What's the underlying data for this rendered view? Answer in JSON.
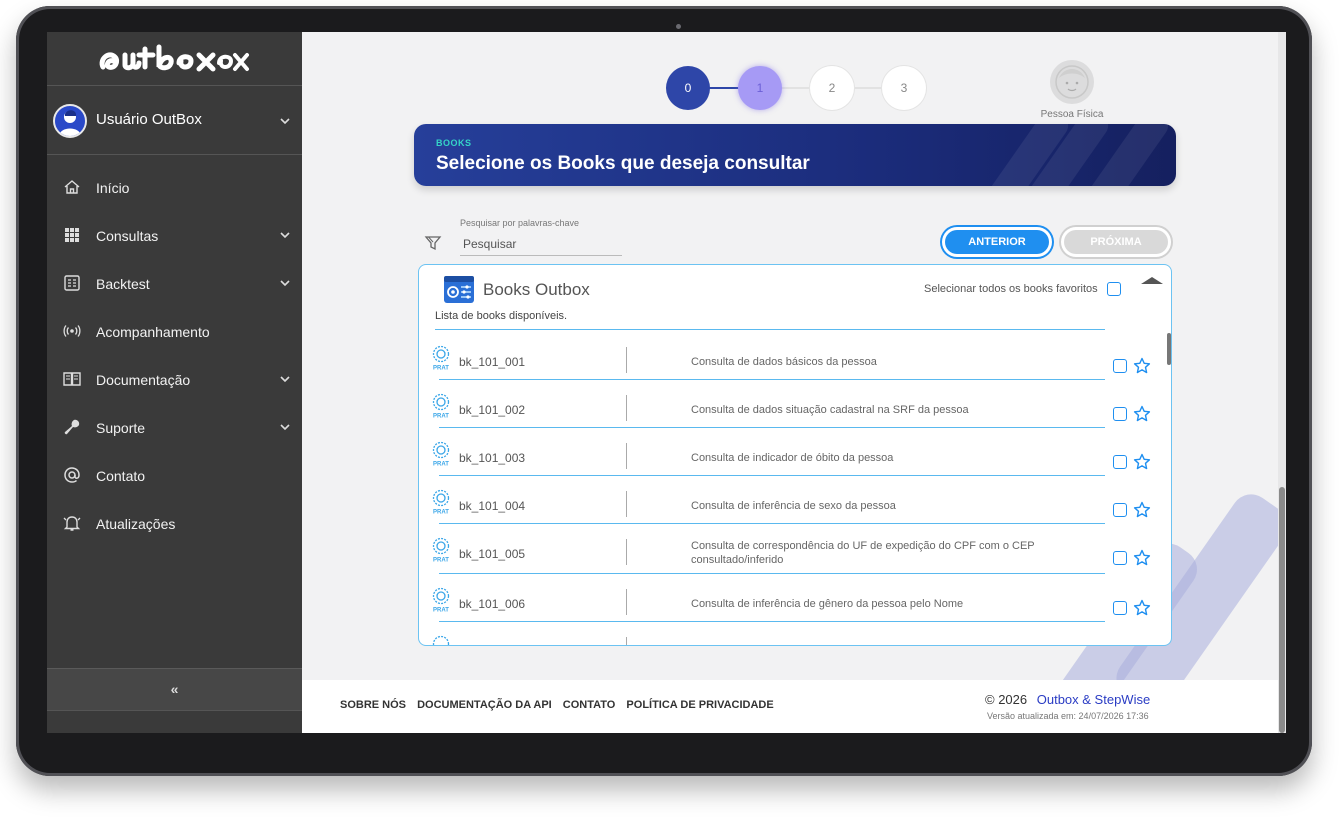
{
  "brand": {
    "logo_text": "outbox"
  },
  "user": {
    "name": "Usuário OutBox"
  },
  "sidebar": {
    "items": [
      {
        "label": "Início",
        "icon": "home-icon",
        "has_submenu": false
      },
      {
        "label": "Consultas",
        "icon": "grid-icon",
        "has_submenu": true
      },
      {
        "label": "Backtest",
        "icon": "backtest-icon",
        "has_submenu": true
      },
      {
        "label": "Acompanhamento",
        "icon": "broadcast-icon",
        "has_submenu": false
      },
      {
        "label": "Documentação",
        "icon": "book-icon",
        "has_submenu": true
      },
      {
        "label": "Suporte",
        "icon": "wrench-icon",
        "has_submenu": true
      },
      {
        "label": "Contato",
        "icon": "at-icon",
        "has_submenu": false
      },
      {
        "label": "Atualizações",
        "icon": "bell-icon",
        "has_submenu": false
      }
    ],
    "collapse_label": "«"
  },
  "stepper": {
    "steps": [
      {
        "label": "0",
        "state": "completed"
      },
      {
        "label": "1",
        "state": "active"
      },
      {
        "label": "2",
        "state": "pending"
      },
      {
        "label": "3",
        "state": "pending"
      }
    ],
    "person_label": "Pessoa Física"
  },
  "banner": {
    "tag": "BOOKS",
    "title": "Selecione os Books que deseja consultar"
  },
  "search": {
    "label": "Pesquisar por palavras-chave",
    "placeholder": "Pesquisar",
    "value": ""
  },
  "nav_buttons": {
    "previous": "ANTERIOR",
    "next": "PRÓXIMA"
  },
  "panel": {
    "title": "Books Outbox",
    "subtitle": "Lista de books disponíveis.",
    "select_all_favorites": "Selecionar todos os books favoritos",
    "badge_text": "PRAT",
    "books": [
      {
        "code": "bk_101_001",
        "description": "Consulta de dados básicos da pessoa"
      },
      {
        "code": "bk_101_002",
        "description": "Consulta de dados situação cadastral na SRF da pessoa"
      },
      {
        "code": "bk_101_003",
        "description": "Consulta de indicador de óbito da pessoa"
      },
      {
        "code": "bk_101_004",
        "description": "Consulta de inferência de sexo da pessoa"
      },
      {
        "code": "bk_101_005",
        "description": "Consulta de correspondência do UF de expedição do CPF com o CEP consultado/inferido"
      },
      {
        "code": "bk_101_006",
        "description": "Consulta de inferência de gênero da pessoa pelo Nome"
      }
    ]
  },
  "footer": {
    "links": [
      "SOBRE NÓS",
      "DOCUMENTAÇÃO DA API",
      "CONTATO",
      "POLÍTICA DE PRIVACIDADE"
    ],
    "copyright": "© 2026",
    "company": "Outbox & StepWise",
    "version": "Versão atualizada em: 24/07/2026 17:36"
  },
  "colors": {
    "sidebar_bg": "#3a3a3a",
    "accent_blue": "#1f8ff0",
    "step_completed": "#2e46a8",
    "step_active": "#a69af5",
    "banner_tag": "#35d4c7",
    "company_link": "#2a3cc4"
  }
}
